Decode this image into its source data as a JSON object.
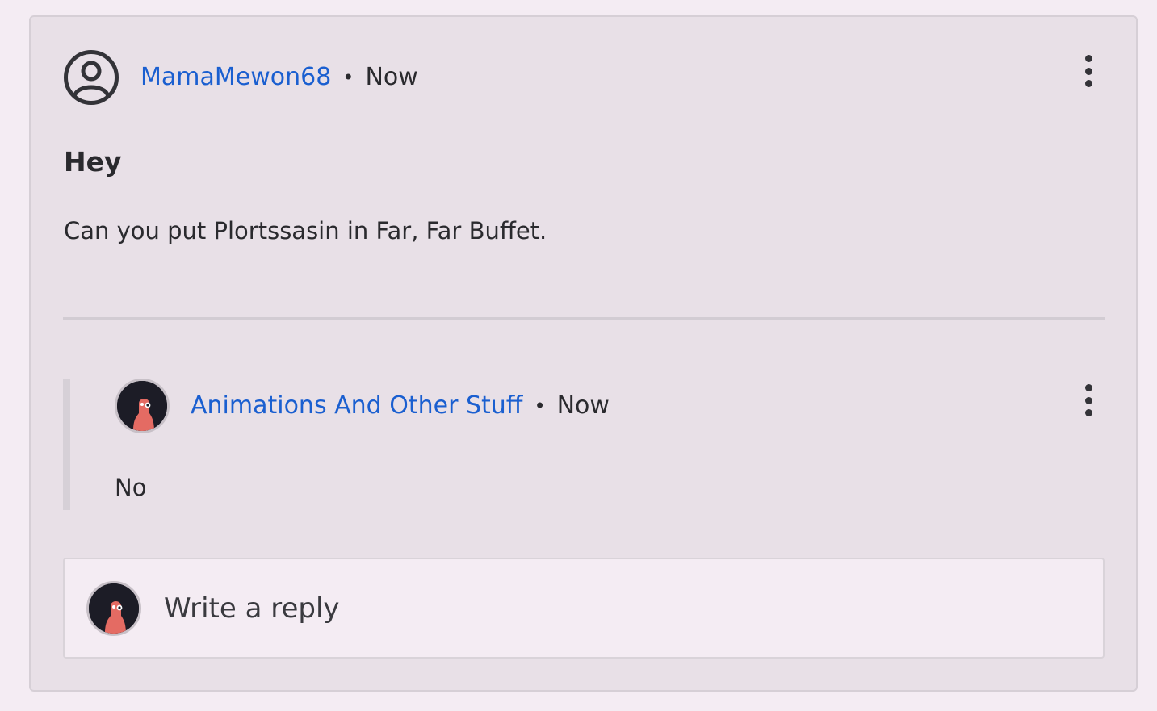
{
  "post": {
    "author": "MamaMewon68",
    "separator": "•",
    "timestamp": "Now",
    "title": "Hey",
    "body": "Can you put Plortssasin in Far, Far Buffet.",
    "avatar_icon": "user-circle-icon",
    "menu_icon": "more-vertical-icon"
  },
  "reply": {
    "author": "Animations And Other Stuff",
    "separator": "•",
    "timestamp": "Now",
    "body": "No",
    "menu_icon": "more-vertical-icon"
  },
  "composer": {
    "placeholder": "Write a reply"
  },
  "colors": {
    "link": "#1a5fd0",
    "card_background": "#e8e0e7",
    "page_background": "#f4ecf3"
  }
}
